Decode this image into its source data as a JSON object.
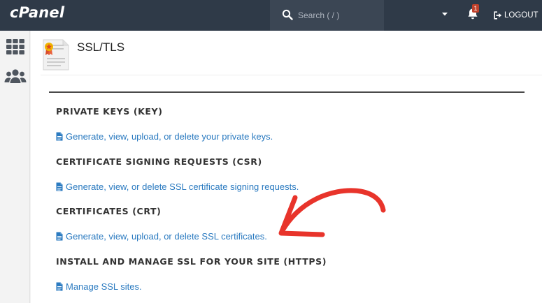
{
  "header": {
    "logo": "cPanel",
    "search_placeholder": "Search ( / )",
    "notification_count": "1",
    "logout_label": "LOGOUT"
  },
  "page": {
    "title": "SSL/TLS"
  },
  "sections": [
    {
      "title": "PRIVATE KEYS (KEY)",
      "link": "Generate, view, upload, or delete your private keys."
    },
    {
      "title": "CERTIFICATE SIGNING REQUESTS (CSR)",
      "link": "Generate, view, or delete SSL certificate signing requests."
    },
    {
      "title": "CERTIFICATES (CRT)",
      "link": "Generate, view, upload, or delete SSL certificates."
    },
    {
      "title": "INSTALL AND MANAGE SSL FOR YOUR SITE (HTTPS)",
      "link": "Manage SSL sites."
    }
  ],
  "colors": {
    "topbar": "#2f3a48",
    "link": "#2a7ac0",
    "annotation_arrow": "#e8342b"
  },
  "icons": {
    "search": "search-icon",
    "notifications": "bell-icon",
    "logout": "logout-icon",
    "apps": "grid-icon",
    "users": "users-icon",
    "page": "certificate-icon",
    "link": "document-icon"
  }
}
